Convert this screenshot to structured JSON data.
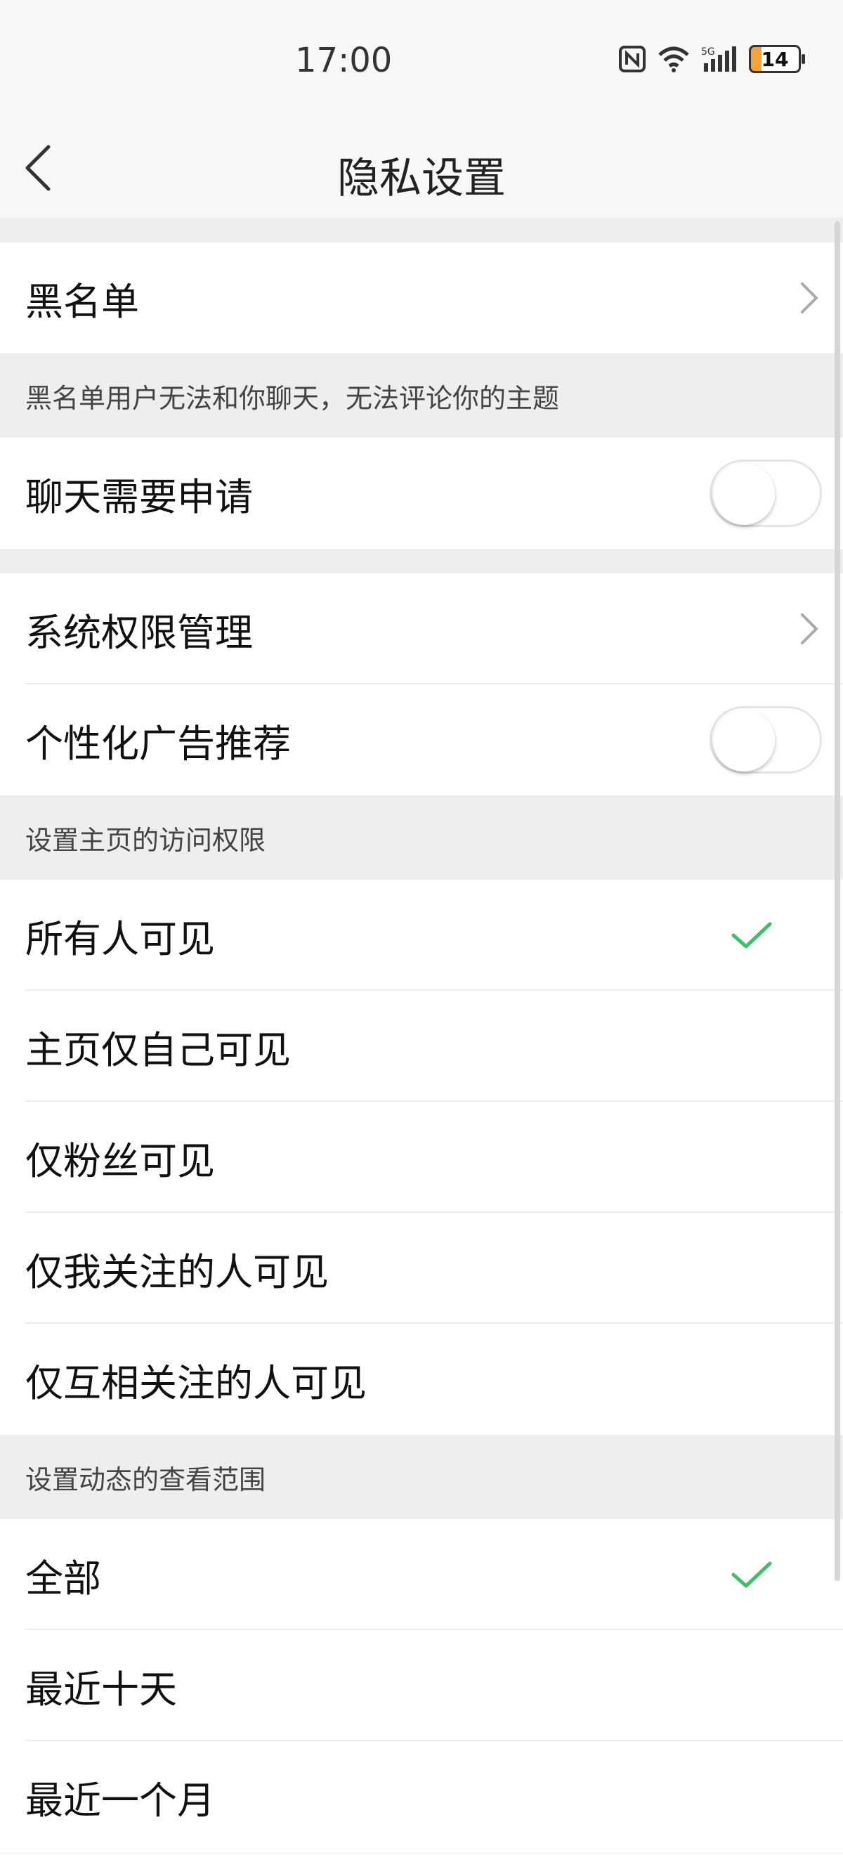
{
  "status": {
    "time": "17:00",
    "battery": "14"
  },
  "header": {
    "title": "隐私设置"
  },
  "sections": {
    "blacklist_label": "黑名单",
    "blacklist_note": "黑名单用户无法和你聊天，无法评论你的主题",
    "chat_apply_label": "聊天需要申请",
    "system_perm_label": "系统权限管理",
    "ads_label": "个性化广告推荐",
    "home_access_note": "设置主页的访问权限",
    "home_options": [
      "所有人可见",
      "主页仅自己可见",
      "仅粉丝可见",
      "仅我关注的人可见",
      "仅互相关注的人可见"
    ],
    "feed_range_note": "设置动态的查看范围",
    "feed_options": [
      "全部",
      "最近十天",
      "最近一个月"
    ]
  },
  "colors": {
    "accent": "#3fbf66",
    "background": "#f7f7f7"
  },
  "toggles": {
    "chat_apply": false,
    "ads": false
  },
  "selected": {
    "home": "所有人可见",
    "feed": "全部"
  }
}
